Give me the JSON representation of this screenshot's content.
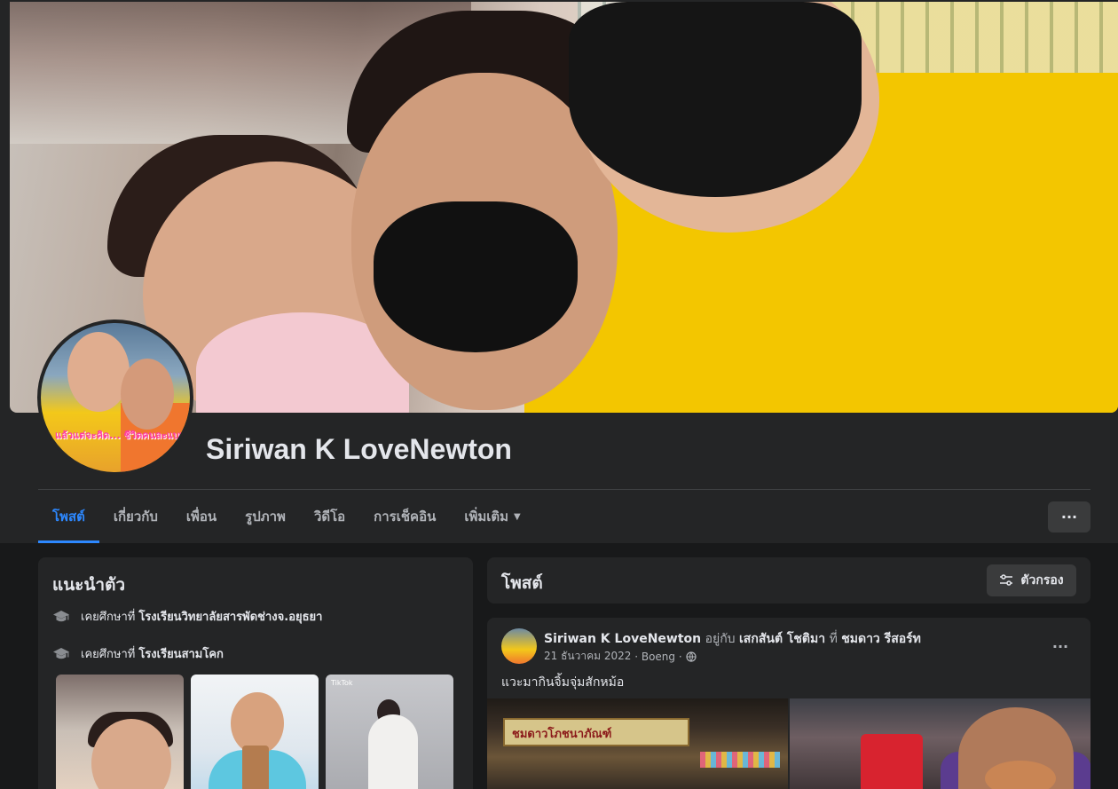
{
  "profile": {
    "name": "Siriwan K LoveNewton",
    "avatar_caption": "แล้วแต่จะคิด... ชีวิตคนละแบบ"
  },
  "nav": {
    "tabs": [
      "โพสต์",
      "เกี่ยวกับ",
      "เพื่อน",
      "รูปภาพ",
      "วิดีโอ",
      "การเช็คอิน",
      "เพิ่มเติม"
    ],
    "active_tab": "โพสต์",
    "more_button_icon": "more-horizontal-icon"
  },
  "intro": {
    "title": "แนะนำตัว",
    "education": [
      {
        "prefix": "เคยศึกษาที่",
        "school": "โรงเรียนวิทยาลัยสารพัดช่างจ.อยุธยา"
      },
      {
        "prefix": "เคยศึกษาที่",
        "school": "โรงเรียนสามโคก"
      }
    ],
    "photo_tiktok_label": "TikTok"
  },
  "posts": {
    "title": "โพสต์",
    "filter_label": "ตัวกรอง"
  },
  "post": {
    "author": "Siriwan K LoveNewton",
    "with_word": "อยู่กับ",
    "tagged": "เสกสันต์ โชติมา",
    "at_word": "ที่",
    "place": "ชมดาว รีสอร์ท",
    "date": "21 ธันวาคม 2022",
    "location": "Boeng",
    "text": "แวะมากินจิ้มจุ่มสักหม้อ",
    "photo_sign": "ชมดาวโภชนาภัณฑ์"
  },
  "colors": {
    "background": "#18191a",
    "card": "#242526",
    "accent": "#2d88ff",
    "secondary_text": "#b0b3b8"
  }
}
